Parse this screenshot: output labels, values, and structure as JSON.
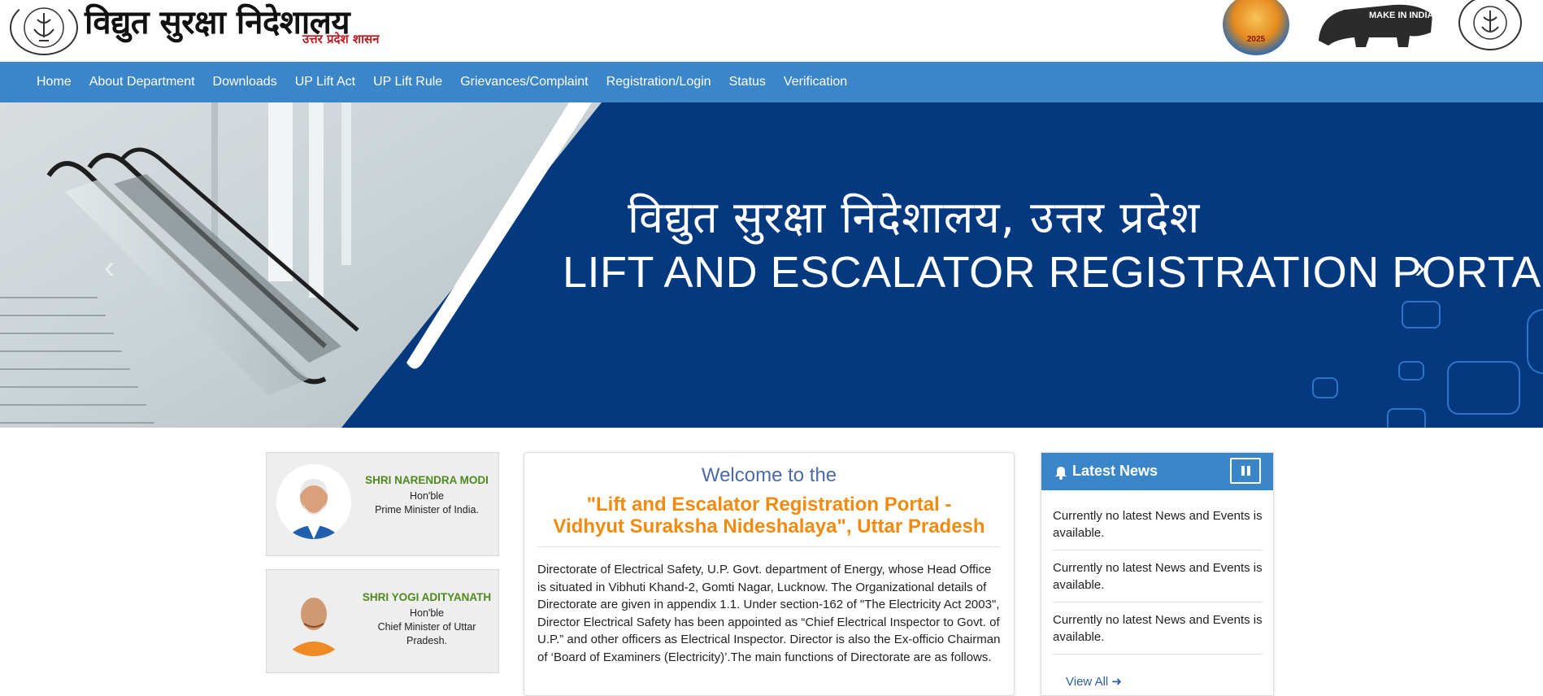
{
  "header": {
    "title_hi": "विद्युत सुरक्षा निदेशालय",
    "subtitle_hi": "उत्तर प्रदेश शासन",
    "kumbh_year": "2025",
    "make_in_india": "MAKE IN INDIA"
  },
  "nav": {
    "items": [
      "Home",
      "About Department",
      "Downloads",
      "UP Lift Act",
      "UP Lift Rule",
      "Grievances/Complaint",
      "Registration/Login",
      "Status",
      "Verification"
    ]
  },
  "banner": {
    "title_hi": "विद्युत सुरक्षा निदेशालय, उत्तर प्रदेश",
    "title_en": "LIFT AND ESCALATOR REGISTRATION PORTAL, U.P.",
    "next_arrow": "›",
    "prev_arrow": "‹"
  },
  "profiles": [
    {
      "name": "SHRI NARENDRA MODI",
      "honorific": "Hon'ble",
      "role": "Prime Minister of India."
    },
    {
      "name": "SHRI YOGI ADITYANATH",
      "honorific": "Hon'ble",
      "role": "Chief Minister of Uttar Pradesh."
    }
  ],
  "welcome": {
    "heading": "Welcome to the",
    "portal_line1": "\"Lift and Escalator Registration Portal -",
    "portal_line2": "Vidhyut Suraksha Nideshalaya\", Uttar Pradesh",
    "body": "Directorate of Electrical Safety, U.P. Govt. department of Energy, whose Head Office is situated in Vibhuti Khand-2, Gomti Nagar, Lucknow. The Organizational details of Directorate are given in appendix 1.1. Under section-162 of \"The Electricity Act 2003\", Director Electrical Safety has been appointed as  “Chief Electrical Inspector to Govt. of U.P.”  and other officers as Electrical Inspector. Director is also the Ex-officio Chairman of  ‘Board of Examiners (Electricity)’.The main functions of Directorate are as follows."
  },
  "news": {
    "title": "Latest News",
    "items": [
      "Currently no latest News and Events is available.",
      "Currently no latest News and Events is available.",
      "Currently no latest News and Events is available."
    ],
    "view_all": "View All ➜"
  },
  "colors": {
    "nav_blue": "#3a86c8",
    "banner_blue": "#04397f",
    "accent_orange": "#f28a0f",
    "name_green": "#4e8a1e",
    "subtitle_red": "#c0171d"
  }
}
